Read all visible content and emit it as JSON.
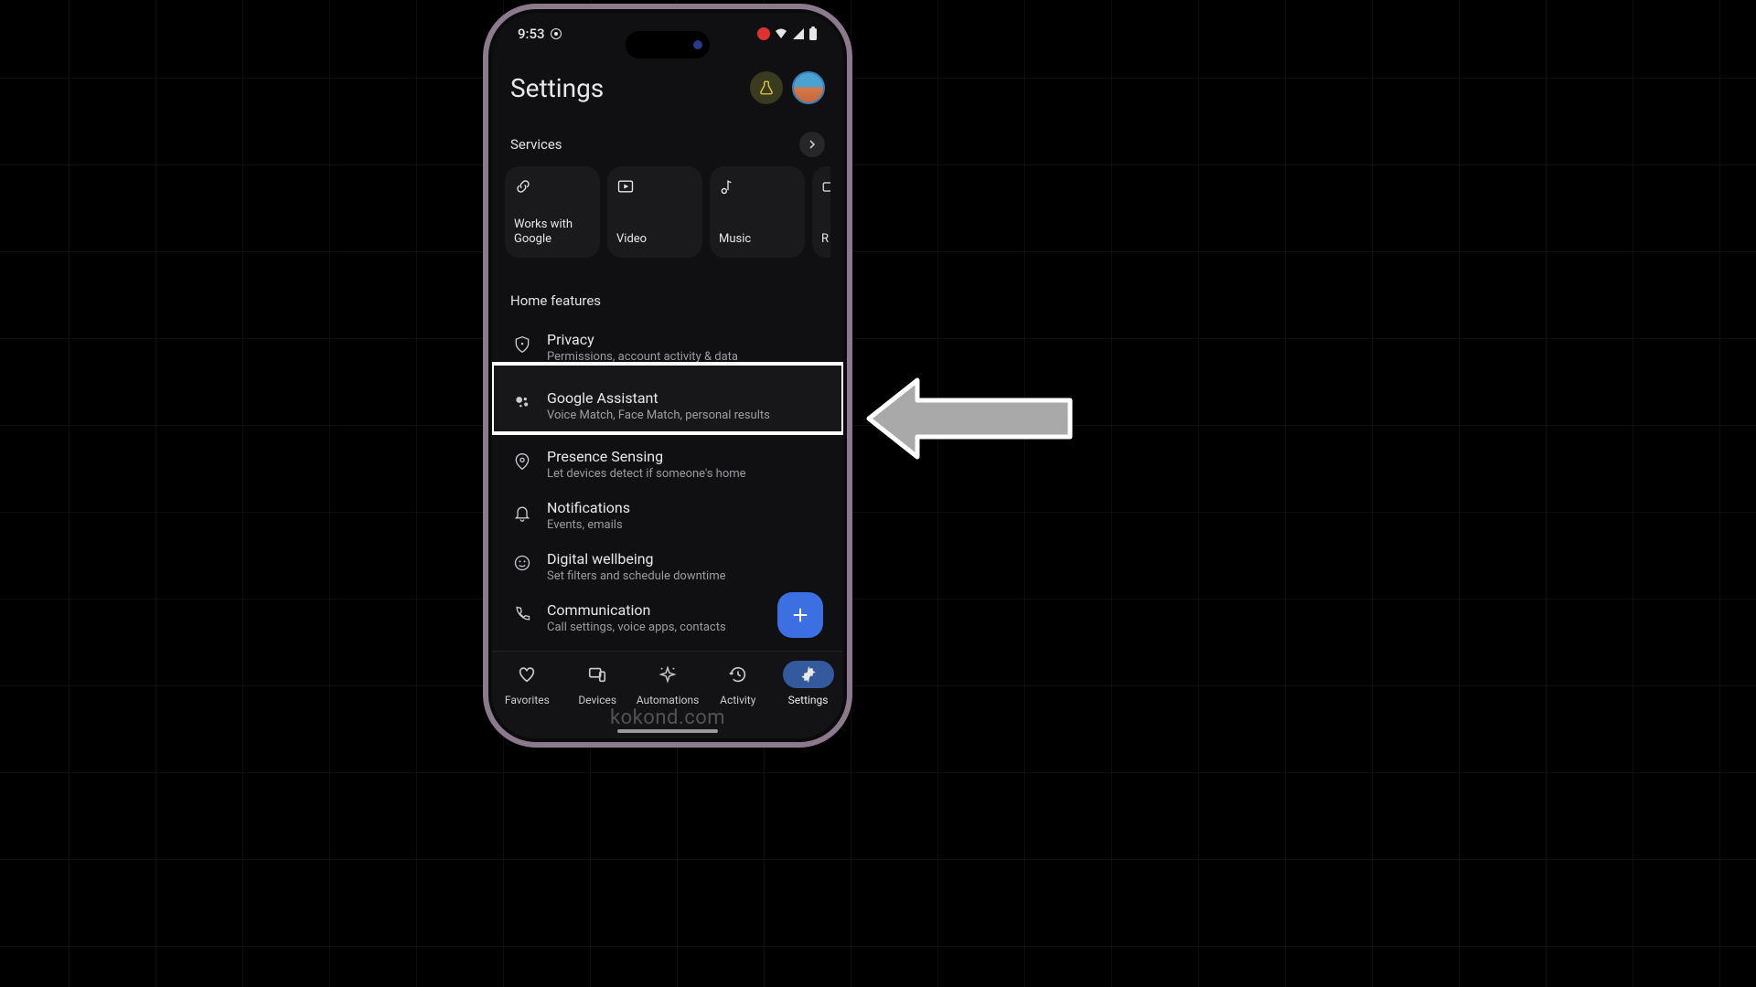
{
  "statusbar": {
    "time": "9:53"
  },
  "header": {
    "title": "Settings"
  },
  "services_section": {
    "label": "Services"
  },
  "services": [
    {
      "label": "Works with\nGoogle"
    },
    {
      "label": "Video"
    },
    {
      "label": "Music"
    },
    {
      "label": "R"
    }
  ],
  "home_features_label": "Home features",
  "features": [
    {
      "title": "Privacy",
      "sub": "Permissions, account activity & data"
    },
    {
      "title": "Google Assistant",
      "sub": "Voice Match, Face Match, personal results"
    },
    {
      "title": "Presence Sensing",
      "sub": "Let devices detect if someone's home"
    },
    {
      "title": "Notifications",
      "sub": "Events, emails"
    },
    {
      "title": "Digital wellbeing",
      "sub": "Set filters and schedule downtime"
    },
    {
      "title": "Communication",
      "sub": "Call settings, voice apps, contacts"
    }
  ],
  "nav": [
    {
      "label": "Favorites"
    },
    {
      "label": "Devices"
    },
    {
      "label": "Automations"
    },
    {
      "label": "Activity"
    },
    {
      "label": "Settings"
    }
  ],
  "watermark": "kokond.com"
}
